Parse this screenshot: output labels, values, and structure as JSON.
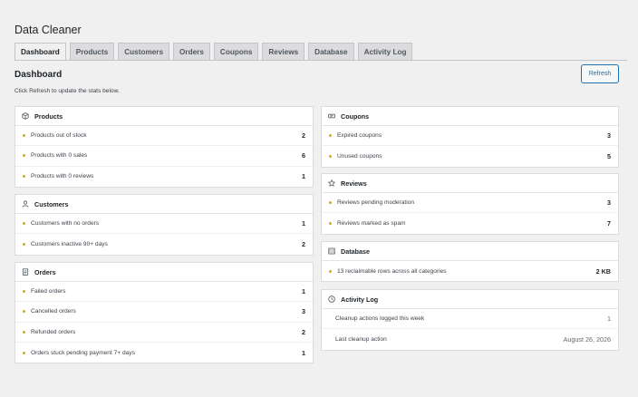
{
  "app": {
    "title": "Data Cleaner"
  },
  "tabs": [
    {
      "label": "Dashboard"
    },
    {
      "label": "Products"
    },
    {
      "label": "Customers"
    },
    {
      "label": "Orders"
    },
    {
      "label": "Coupons"
    },
    {
      "label": "Reviews"
    },
    {
      "label": "Database"
    },
    {
      "label": "Activity Log"
    }
  ],
  "page": {
    "heading": "Dashboard",
    "hint": "Click Refresh to update the stats below.",
    "refresh_label": "Refresh"
  },
  "colors": {
    "accent": "#2271b1",
    "bullet": "#dba617"
  },
  "cards": {
    "products": {
      "title": "Products",
      "icon": "box-icon",
      "rows": [
        {
          "label": "Products out of stock",
          "value": "2"
        },
        {
          "label": "Products with 0 sales",
          "value": "6"
        },
        {
          "label": "Products with 0 reviews",
          "value": "1"
        }
      ]
    },
    "customers": {
      "title": "Customers",
      "icon": "user-icon",
      "rows": [
        {
          "label": "Customers with no orders",
          "value": "1"
        },
        {
          "label": "Customers inactive 90+ days",
          "value": "2"
        }
      ]
    },
    "orders": {
      "title": "Orders",
      "icon": "clipboard-icon",
      "rows": [
        {
          "label": "Failed orders",
          "value": "1"
        },
        {
          "label": "Cancelled orders",
          "value": "3"
        },
        {
          "label": "Refunded orders",
          "value": "2"
        },
        {
          "label": "Orders stuck pending payment 7+ days",
          "value": "1"
        }
      ]
    },
    "coupons": {
      "title": "Coupons",
      "icon": "ticket-icon",
      "rows": [
        {
          "label": "Expired coupons",
          "value": "3"
        },
        {
          "label": "Unused coupons",
          "value": "5"
        }
      ]
    },
    "reviews": {
      "title": "Reviews",
      "icon": "star-icon",
      "rows": [
        {
          "label": "Reviews pending moderation",
          "value": "3"
        },
        {
          "label": "Reviews marked as spam",
          "value": "7"
        }
      ]
    },
    "database": {
      "title": "Database",
      "icon": "database-icon",
      "rows": [
        {
          "label": "13 reclaimable rows across all categories",
          "value": "2 KB"
        }
      ]
    },
    "activity": {
      "title": "Activity Log",
      "icon": "clock-icon",
      "rows": [
        {
          "label": "Cleanup actions logged this week",
          "value": "1"
        },
        {
          "label": "Last cleanup action",
          "value": "August 26, 2026"
        }
      ]
    }
  }
}
